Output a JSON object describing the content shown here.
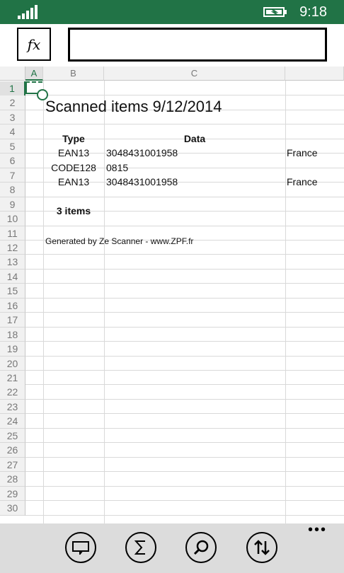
{
  "status": {
    "time": "9:18"
  },
  "formula_bar": {
    "fx_label": "fx",
    "value": ""
  },
  "grid": {
    "columns": [
      "A",
      "B",
      "C"
    ],
    "row_numbers": [
      "1",
      "2",
      "3",
      "4",
      "5",
      "6",
      "7",
      "8",
      "9",
      "10",
      "11",
      "12",
      "13",
      "14",
      "15",
      "16",
      "17",
      "18",
      "19",
      "20",
      "21",
      "22",
      "23",
      "24",
      "25",
      "26",
      "27",
      "28",
      "29",
      "30"
    ],
    "selected_cell": "A1",
    "cells": {
      "title": "Scanned items 9/12/2014",
      "header_type": "Type",
      "header_data": "Data",
      "r5_type": "EAN13",
      "r5_data": "3048431001958",
      "r5_country": "France",
      "r6_type": "CODE128",
      "r6_data": "0815",
      "r7_type": "EAN13",
      "r7_data": "3048431001958",
      "r7_country": "France",
      "count": "3 items",
      "footer": "Generated by Ze Scanner - www.ZPF.fr"
    }
  },
  "appbar": {
    "buttons": [
      "sheets-icon",
      "sum-icon",
      "search-icon",
      "sort-icon"
    ],
    "more_label": "•••"
  },
  "colors": {
    "accent": "#217346"
  }
}
